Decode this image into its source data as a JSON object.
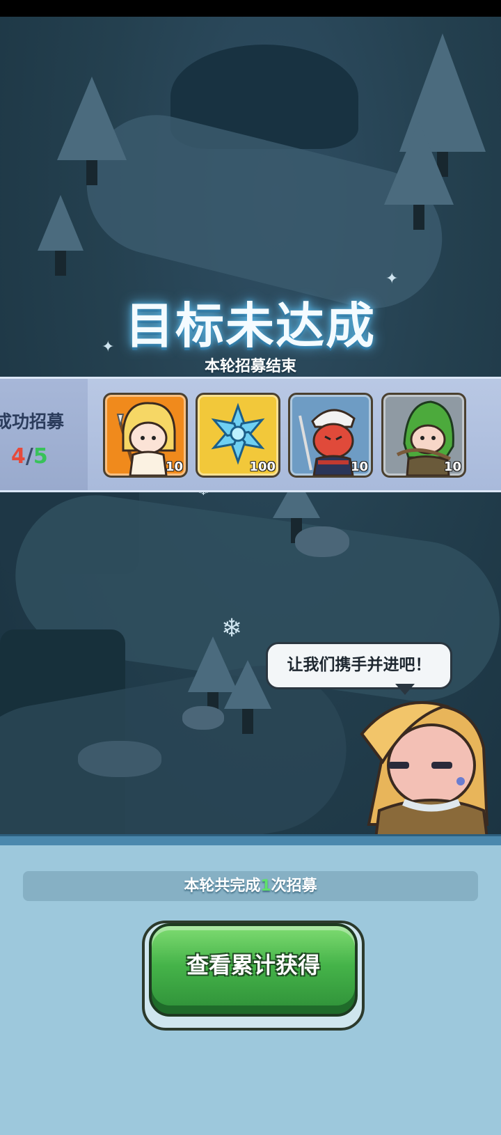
{
  "result": {
    "title": "目标未达成",
    "subtitle": "本轮招募结束"
  },
  "recruit": {
    "label": "成功招募",
    "current": "4",
    "separator": "/",
    "max": "5"
  },
  "rewards": [
    {
      "name": "spear-hero",
      "amount": "10",
      "bg": "#f08a1c"
    },
    {
      "name": "ice-crystal",
      "amount": "100",
      "bg": "#f2c83a"
    },
    {
      "name": "red-oni-warrior",
      "amount": "10",
      "bg": "#6e9cc4"
    },
    {
      "name": "green-hood-archer",
      "amount": "10",
      "bg": "#8f9aa3"
    }
  ],
  "dialog": {
    "text": "让我们携手并进吧！"
  },
  "summary": {
    "prefix": "本轮共完成",
    "count": "1",
    "suffix": "次招募"
  },
  "button": {
    "label": "查看累计获得"
  },
  "colors": {
    "title_glow": "#68c2f0",
    "count_current": "#e64a3c",
    "count_max": "#38c25a",
    "button_green": "#45b349",
    "panel_blue": "#9dc8dc"
  }
}
